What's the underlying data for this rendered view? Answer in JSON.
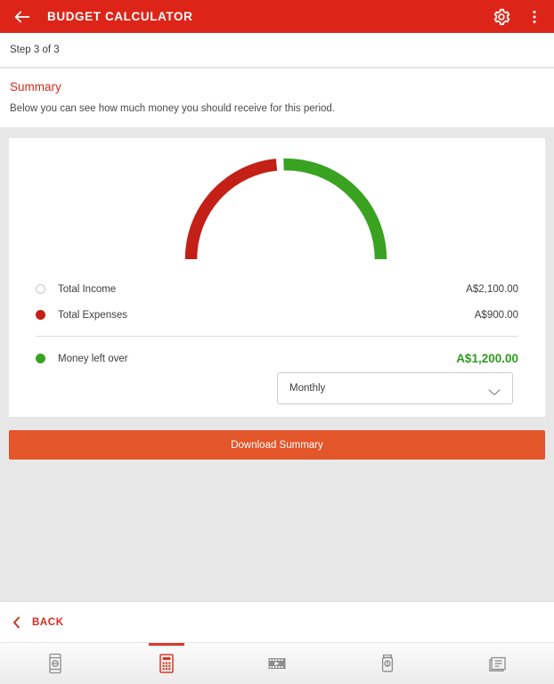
{
  "appbar": {
    "title": "BUDGET CALCULATOR",
    "back_icon": "arrow-left-icon",
    "settings_icon": "gear-icon",
    "overflow_icon": "more-vertical-icon",
    "background_color": "#dc2518"
  },
  "step": {
    "text": "Step 3 of 3",
    "current": 3,
    "total": 3
  },
  "summary": {
    "title": "Summary",
    "description": "Below you can see how much money you should receive for this period.",
    "title_color": "#d32b1e"
  },
  "gauge": {
    "expense_color": "#c32017",
    "income_color": "#3aa221",
    "expense_sweep_degrees": 85,
    "remaining_sweep_degrees": 88,
    "track_thickness": 13
  },
  "legend": [
    {
      "label": "Total Income",
      "value": "A$2,100.00",
      "marker": "hollow-circle",
      "marker_color": "#ffffff"
    },
    {
      "label": "Total Expenses",
      "value": "A$900.00",
      "marker": "filled-circle",
      "marker_color": "#c32017"
    },
    {
      "label": "Money left over",
      "value": "A$1,200.00",
      "marker": "filled-circle",
      "marker_color": "#3aa221",
      "emphasized": true
    }
  ],
  "period_select": {
    "value": "Monthly",
    "chevron_icon": "chevron-down-icon",
    "options": [
      "Monthly"
    ]
  },
  "download": {
    "label": "Download Summary",
    "color": "#e3562a"
  },
  "back": {
    "label": "BACK",
    "chevron_icon": "chevron-left-icon",
    "color": "#d32b1e"
  },
  "tabs": [
    {
      "name": "mobile-money",
      "icon": "mobile-phone-money-icon",
      "active": false
    },
    {
      "name": "calculator",
      "icon": "calculator-icon",
      "active": true
    },
    {
      "name": "videos",
      "icon": "film-play-icon",
      "active": false
    },
    {
      "name": "savings",
      "icon": "savings-jar-icon",
      "active": false
    },
    {
      "name": "articles",
      "icon": "document-list-icon",
      "active": false
    }
  ],
  "chart_data": {
    "type": "pie",
    "title": "Budget breakdown gauge",
    "categories": [
      "Total Expenses",
      "Money left over"
    ],
    "values": [
      900,
      1200
    ],
    "total": 2100,
    "currency": "A$",
    "colors": [
      "#c32017",
      "#3aa221"
    ],
    "labels": [
      "A$900.00",
      "A$1,200.00"
    ],
    "legend": "inline-below",
    "notes": "Half-donut gauge: expenses arc (red) spans the left portion, money left over arc (green) spans the right portion."
  }
}
